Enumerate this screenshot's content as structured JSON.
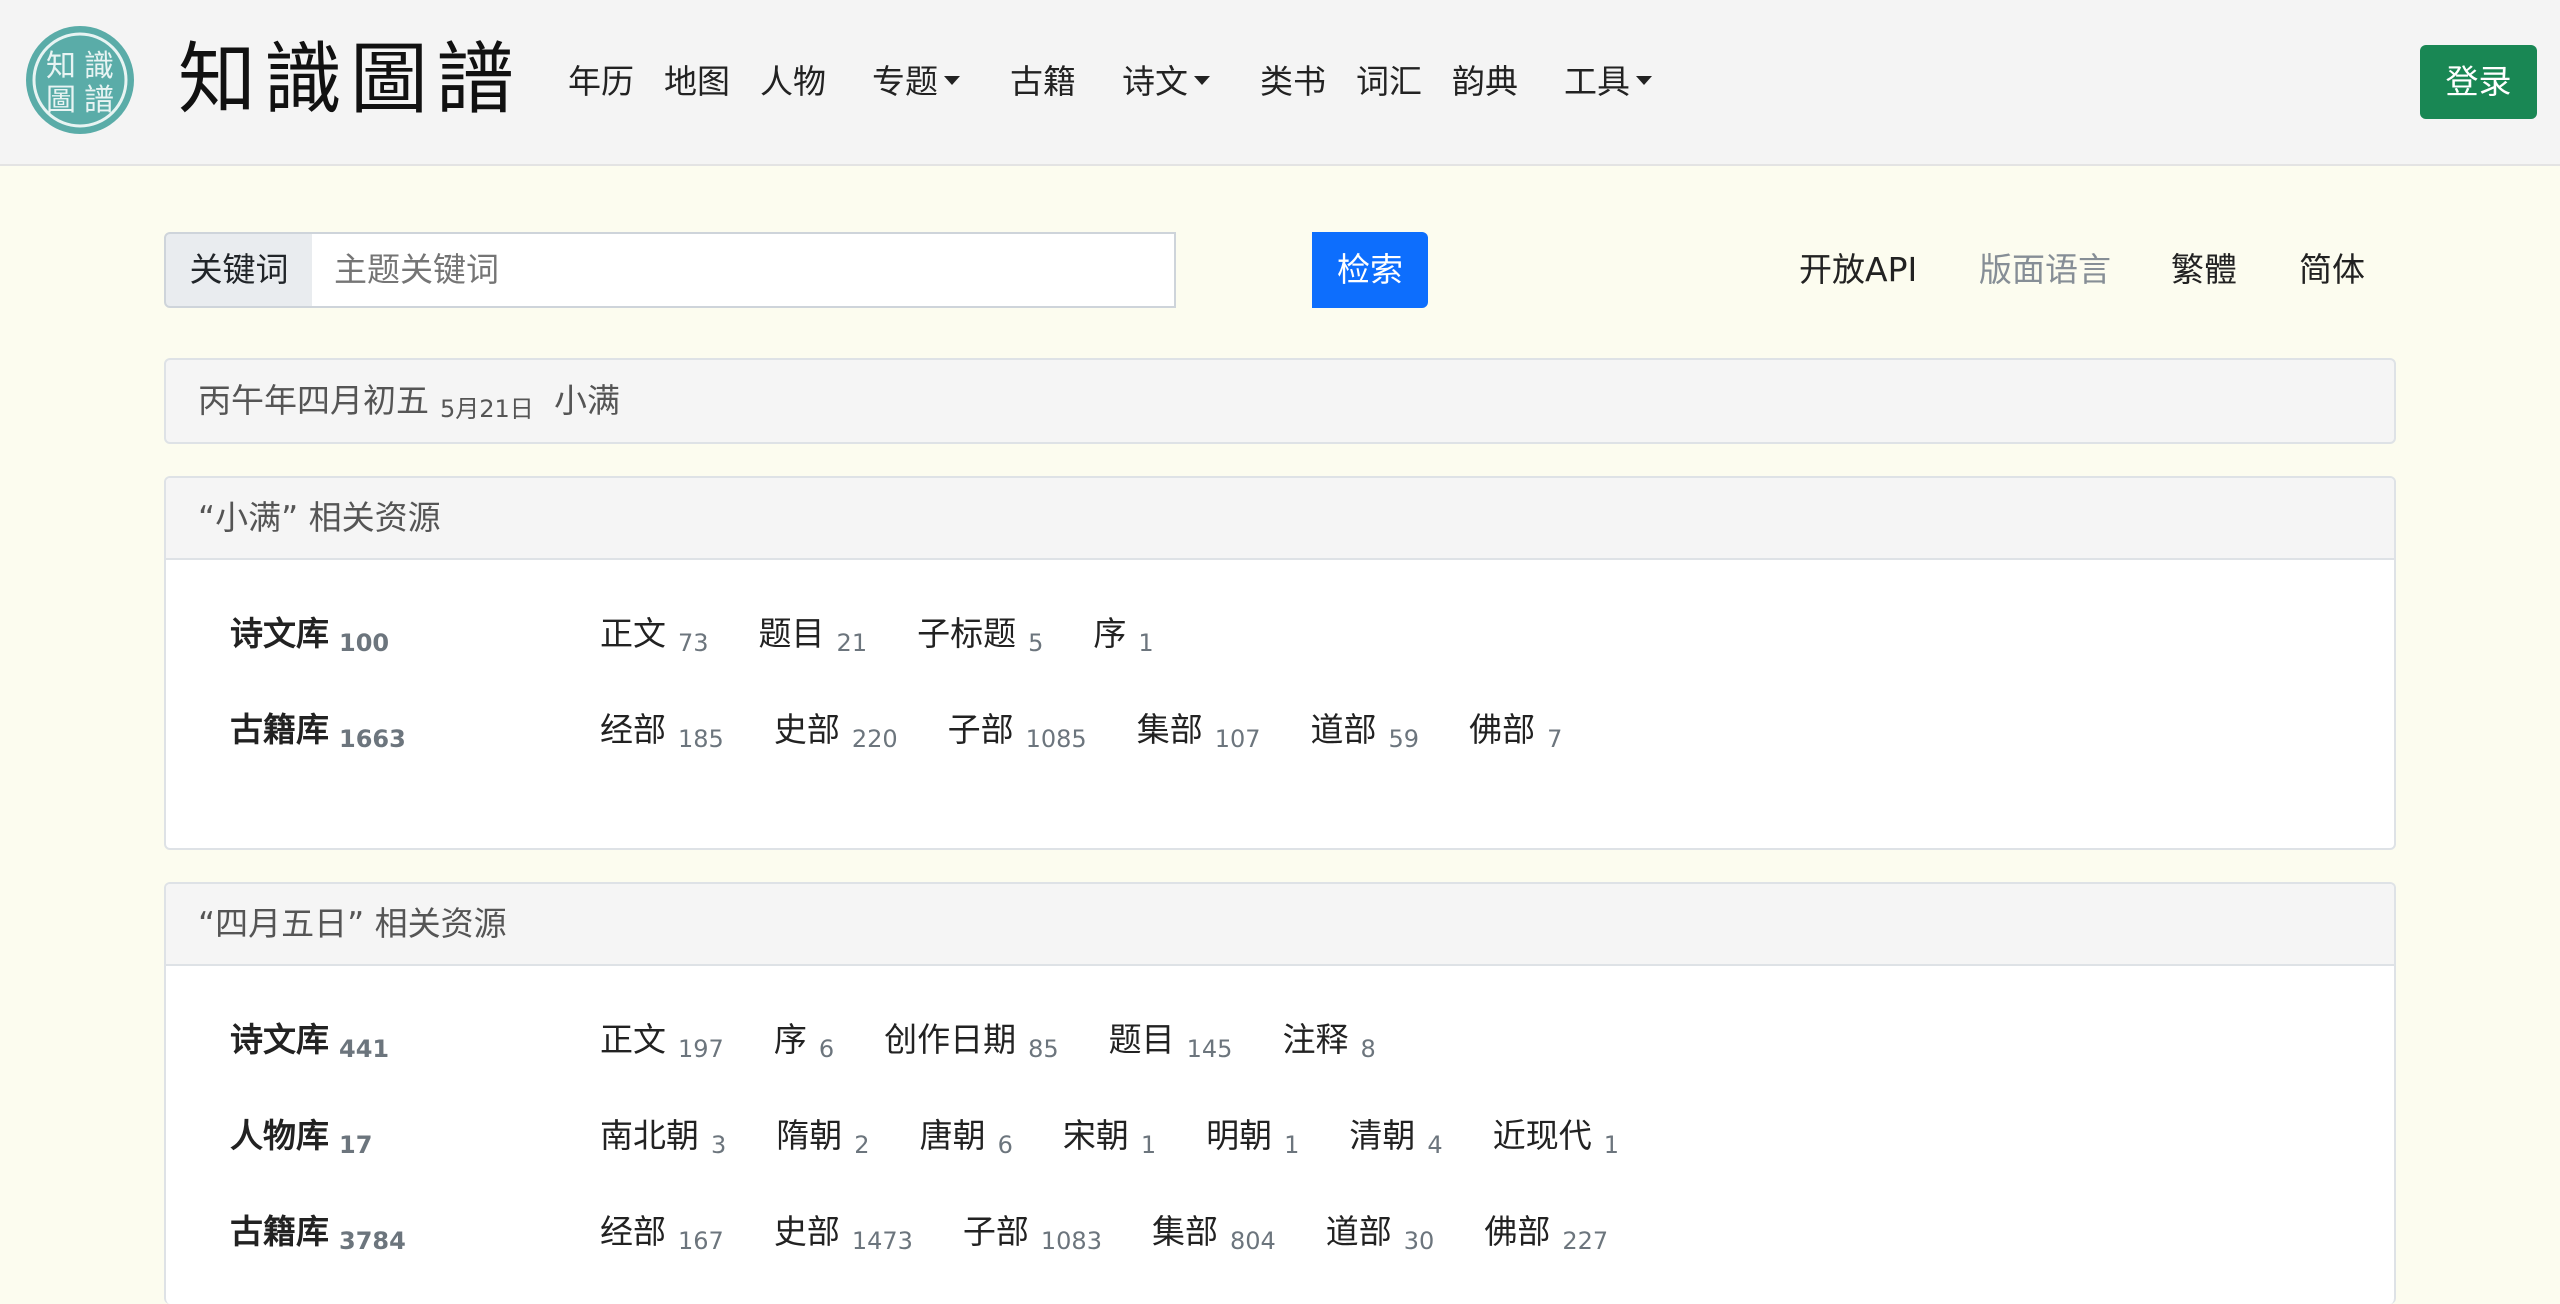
{
  "brand": {
    "title": "知識圖譜",
    "logo_text": [
      "知",
      "識",
      "圖",
      "譜"
    ]
  },
  "nav": {
    "items": [
      {
        "label": "年历",
        "dropdown": false
      },
      {
        "label": "地图",
        "dropdown": false
      },
      {
        "label": "人物",
        "dropdown": false
      },
      {
        "label": "专题",
        "dropdown": true
      },
      {
        "label": "古籍",
        "dropdown": false
      },
      {
        "label": "诗文",
        "dropdown": true
      },
      {
        "label": "类书",
        "dropdown": false
      },
      {
        "label": "词汇",
        "dropdown": false
      },
      {
        "label": "韵典",
        "dropdown": false
      },
      {
        "label": "工具",
        "dropdown": true
      }
    ],
    "login_label": "登录"
  },
  "search": {
    "label": "关键词",
    "placeholder": "主题关键词",
    "value": "",
    "button_label": "检索"
  },
  "top_links": {
    "api": "开放API",
    "layout_language": "版面语言",
    "traditional": "繁體",
    "simplified": "简体"
  },
  "date": {
    "lunar": "丙午年四月初五",
    "solar": "5月21日",
    "solar_term": "小满"
  },
  "cards": [
    {
      "title": "“小满” 相关资源",
      "rows": [
        {
          "name": "诗文库",
          "count": "100",
          "items": [
            {
              "label": "正文",
              "count": "73"
            },
            {
              "label": "题目",
              "count": "21"
            },
            {
              "label": "子标题",
              "count": "5"
            },
            {
              "label": "序",
              "count": "1"
            }
          ]
        },
        {
          "name": "古籍库",
          "count": "1663",
          "items": [
            {
              "label": "经部",
              "count": "185"
            },
            {
              "label": "史部",
              "count": "220"
            },
            {
              "label": "子部",
              "count": "1085"
            },
            {
              "label": "集部",
              "count": "107"
            },
            {
              "label": "道部",
              "count": "59"
            },
            {
              "label": "佛部",
              "count": "7"
            }
          ]
        }
      ]
    },
    {
      "title": "“四月五日” 相关资源",
      "rows": [
        {
          "name": "诗文库",
          "count": "441",
          "items": [
            {
              "label": "正文",
              "count": "197"
            },
            {
              "label": "序",
              "count": "6"
            },
            {
              "label": "创作日期",
              "count": "85"
            },
            {
              "label": "题目",
              "count": "145"
            },
            {
              "label": "注释",
              "count": "8"
            }
          ]
        },
        {
          "name": "人物库",
          "count": "17",
          "items": [
            {
              "label": "南北朝",
              "count": "3"
            },
            {
              "label": "隋朝",
              "count": "2"
            },
            {
              "label": "唐朝",
              "count": "6"
            },
            {
              "label": "宋朝",
              "count": "1"
            },
            {
              "label": "明朝",
              "count": "1"
            },
            {
              "label": "清朝",
              "count": "4"
            },
            {
              "label": "近现代",
              "count": "1"
            }
          ]
        },
        {
          "name": "古籍库",
          "count": "3784",
          "items": [
            {
              "label": "经部",
              "count": "167"
            },
            {
              "label": "史部",
              "count": "1473"
            },
            {
              "label": "子部",
              "count": "1083"
            },
            {
              "label": "集部",
              "count": "804"
            },
            {
              "label": "道部",
              "count": "30"
            },
            {
              "label": "佛部",
              "count": "227"
            }
          ]
        }
      ]
    }
  ],
  "colors": {
    "page_bg": "#fcfcef",
    "navbar_bg": "#f4f4f4",
    "login_button": "#198754",
    "search_button": "#0d6efd",
    "logo_teal": "#5aaca8"
  },
  "icons": [
    "seal-logo-icon",
    "caret-down-icon"
  ]
}
